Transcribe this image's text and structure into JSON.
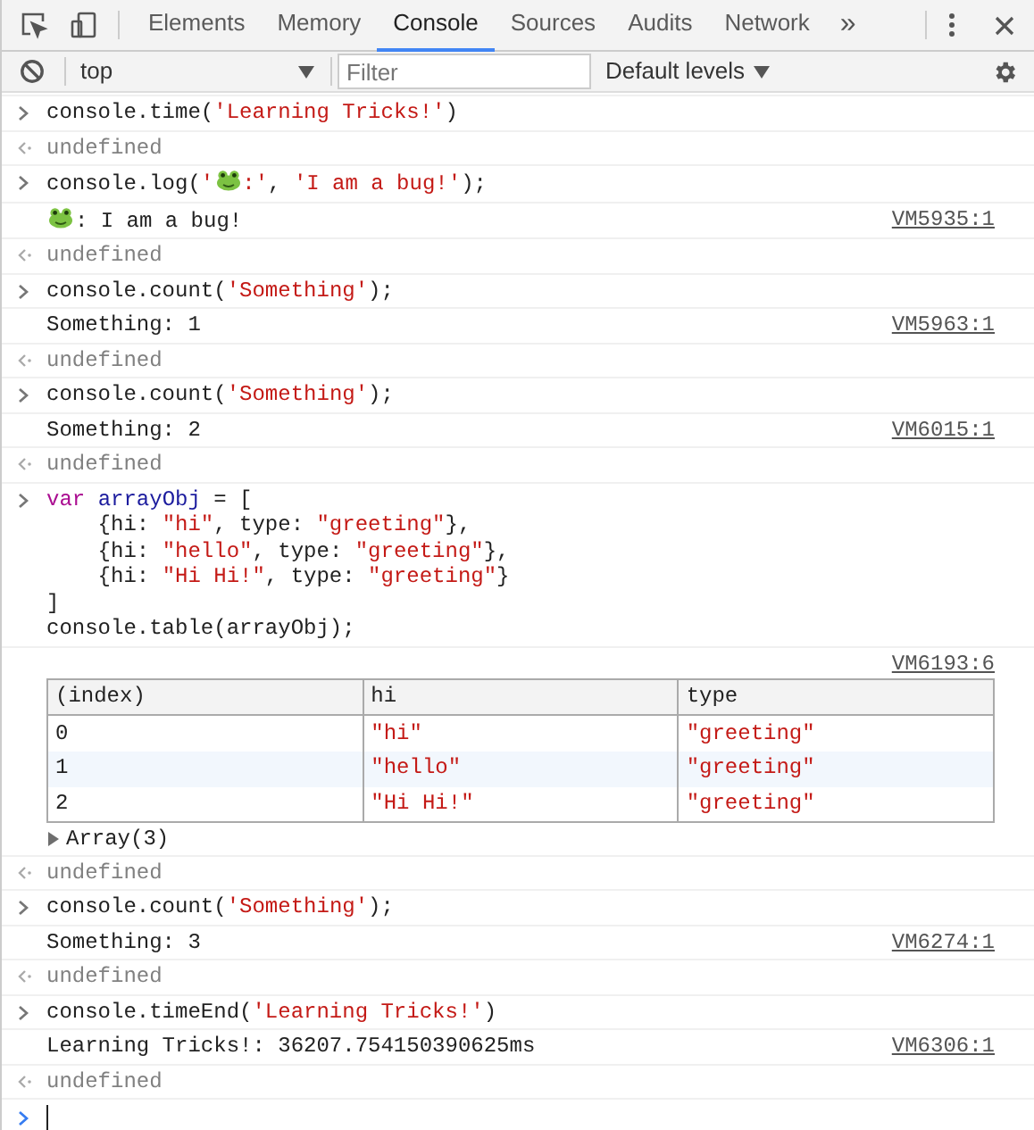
{
  "tabs": [
    {
      "label": "Elements",
      "selected": false
    },
    {
      "label": "Memory",
      "selected": false
    },
    {
      "label": "Console",
      "selected": true
    },
    {
      "label": "Sources",
      "selected": false
    },
    {
      "label": "Audits",
      "selected": false
    },
    {
      "label": "Network",
      "selected": false
    }
  ],
  "more_tabs": "»",
  "context": {
    "value": "top"
  },
  "filter": {
    "placeholder": "Filter"
  },
  "levels": {
    "label": "Default levels"
  },
  "entries": [
    {
      "kind": "input",
      "lines": [
        [
          {
            "kind": "plain",
            "text": "console.time("
          },
          {
            "kind": "string",
            "text": "'Learning Tricks!'"
          },
          {
            "kind": "plain",
            "text": ")"
          }
        ]
      ]
    },
    {
      "kind": "result",
      "text": "undefined"
    },
    {
      "kind": "input",
      "lines": [
        [
          {
            "kind": "plain",
            "text": "console.log("
          },
          {
            "kind": "string",
            "text": "'"
          },
          {
            "kind": "frog"
          },
          {
            "kind": "string",
            "text": ":'"
          },
          {
            "kind": "plain",
            "text": ", "
          },
          {
            "kind": "string",
            "text": "'I am a bug!'"
          },
          {
            "kind": "plain",
            "text": ");"
          }
        ]
      ]
    },
    {
      "kind": "output",
      "parts": [
        {
          "kind": "frog"
        },
        {
          "kind": "plain",
          "text": ": I am a bug!"
        }
      ],
      "source": "VM5935:1"
    },
    {
      "kind": "result",
      "text": "undefined"
    },
    {
      "kind": "input",
      "lines": [
        [
          {
            "kind": "plain",
            "text": "console.count("
          },
          {
            "kind": "string",
            "text": "'Something'"
          },
          {
            "kind": "plain",
            "text": ");"
          }
        ]
      ]
    },
    {
      "kind": "output",
      "parts": [
        {
          "kind": "plain",
          "text": "Something: 1"
        }
      ],
      "source": "VM5963:1"
    },
    {
      "kind": "result",
      "text": "undefined"
    },
    {
      "kind": "input",
      "lines": [
        [
          {
            "kind": "plain",
            "text": "console.count("
          },
          {
            "kind": "string",
            "text": "'Something'"
          },
          {
            "kind": "plain",
            "text": ");"
          }
        ]
      ]
    },
    {
      "kind": "output",
      "parts": [
        {
          "kind": "plain",
          "text": "Something: 2"
        }
      ],
      "source": "VM6015:1"
    },
    {
      "kind": "result",
      "text": "undefined"
    },
    {
      "kind": "input",
      "lines": [
        [
          {
            "kind": "keyword",
            "text": "var "
          },
          {
            "kind": "name",
            "text": "arrayObj"
          },
          {
            "kind": "plain",
            "text": " = ["
          }
        ],
        [
          {
            "kind": "plain",
            "text": "    {hi: "
          },
          {
            "kind": "string",
            "text": "\"hi\""
          },
          {
            "kind": "plain",
            "text": ", type: "
          },
          {
            "kind": "string",
            "text": "\"greeting\""
          },
          {
            "kind": "plain",
            "text": "},"
          }
        ],
        [
          {
            "kind": "plain",
            "text": "    {hi: "
          },
          {
            "kind": "string",
            "text": "\"hello\""
          },
          {
            "kind": "plain",
            "text": ", type: "
          },
          {
            "kind": "string",
            "text": "\"greeting\""
          },
          {
            "kind": "plain",
            "text": "},"
          }
        ],
        [
          {
            "kind": "plain",
            "text": "    {hi: "
          },
          {
            "kind": "string",
            "text": "\"Hi Hi!\""
          },
          {
            "kind": "plain",
            "text": ", type: "
          },
          {
            "kind": "string",
            "text": "\"greeting\""
          },
          {
            "kind": "plain",
            "text": "}"
          }
        ],
        [
          {
            "kind": "plain",
            "text": "]"
          }
        ],
        [
          {
            "kind": "plain",
            "text": "console.table(arrayObj);"
          }
        ]
      ]
    },
    {
      "kind": "table",
      "source": "VM6193:6",
      "columns": [
        "(index)",
        "hi",
        "type"
      ],
      "rows": [
        [
          "0",
          "\"hi\"",
          "\"greeting\""
        ],
        [
          "1",
          "\"hello\"",
          "\"greeting\""
        ],
        [
          "2",
          "\"Hi Hi!\"",
          "\"greeting\""
        ]
      ],
      "summary": {
        "text": "Array(3)",
        "expanded": false
      }
    },
    {
      "kind": "result",
      "text": "undefined"
    },
    {
      "kind": "input",
      "lines": [
        [
          {
            "kind": "plain",
            "text": "console.count("
          },
          {
            "kind": "string",
            "text": "'Something'"
          },
          {
            "kind": "plain",
            "text": ");"
          }
        ]
      ]
    },
    {
      "kind": "output",
      "parts": [
        {
          "kind": "plain",
          "text": "Something: 3"
        }
      ],
      "source": "VM6274:1"
    },
    {
      "kind": "result",
      "text": "undefined"
    },
    {
      "kind": "input",
      "lines": [
        [
          {
            "kind": "plain",
            "text": "console.timeEnd("
          },
          {
            "kind": "string",
            "text": "'Learning Tricks!'"
          },
          {
            "kind": "plain",
            "text": ")"
          }
        ]
      ]
    },
    {
      "kind": "output",
      "parts": [
        {
          "kind": "plain",
          "text": "Learning Tricks!: 36207.754150390625ms"
        }
      ],
      "source": "VM6306:1"
    },
    {
      "kind": "result",
      "text": "undefined"
    }
  ]
}
